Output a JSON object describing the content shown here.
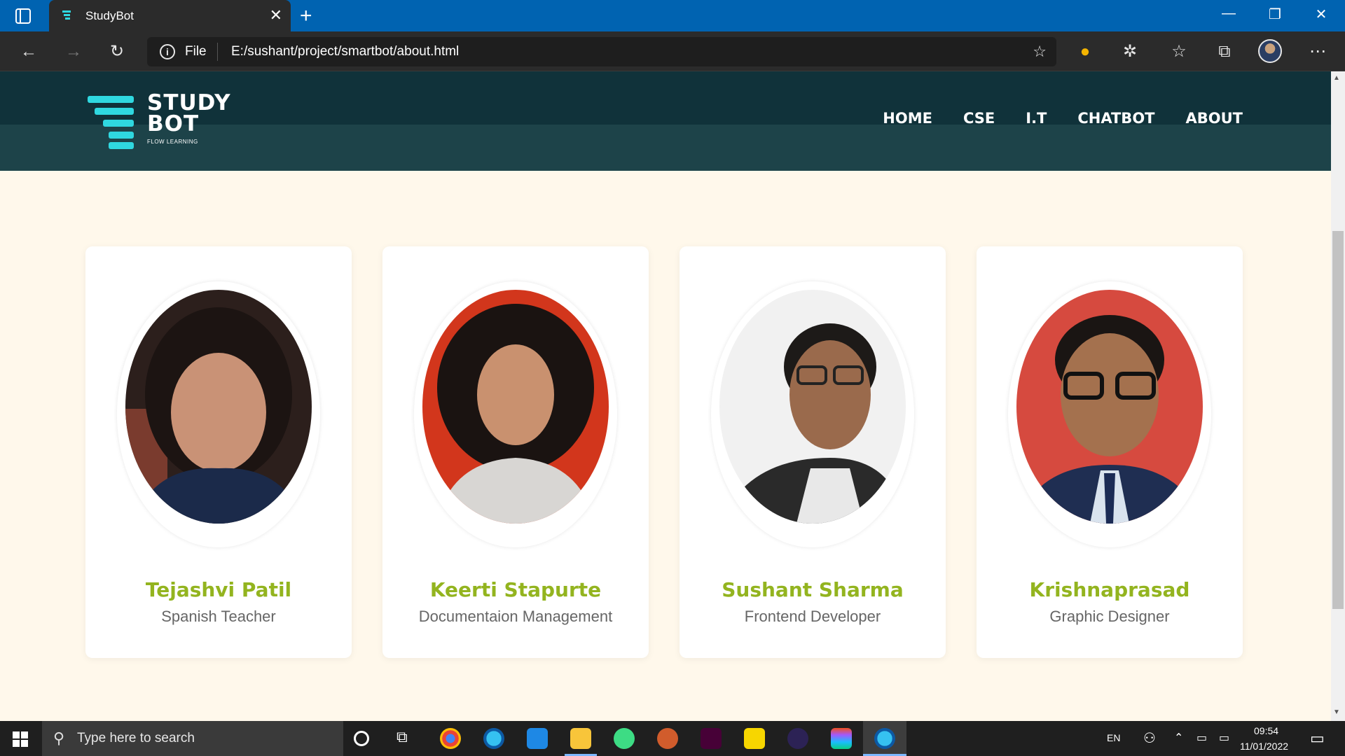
{
  "browser": {
    "tab_title": "StudyBot",
    "tab_close": "✕",
    "new_tab": "+",
    "address_scheme": "File",
    "address_url": "E:/sushant/project/smartbot/about.html",
    "window_controls": {
      "minimize": "—",
      "restore": "❐",
      "close": "✕"
    }
  },
  "site": {
    "logo_line1": "STUDY",
    "logo_line2": "BOT",
    "logo_sub": "FLOW LEARNING",
    "nav": [
      "HOME",
      "CSE",
      "I.T",
      "CHATBOT",
      "ABOUT"
    ],
    "colors": {
      "header": "#10323a",
      "accent": "#2fd8e0",
      "name": "#93b41f",
      "background": "#fff8eb"
    }
  },
  "team": [
    {
      "name": "Tejashvi Patil",
      "role": "Spanish Teacher",
      "photo_bg": "#2c1f1c"
    },
    {
      "name": "Keerti Stapurte",
      "role": "Documentaion Management",
      "photo_bg": "#d2361c"
    },
    {
      "name": "Sushant Sharma",
      "role": "Frontend Developer",
      "photo_bg": "#f1f1f1"
    },
    {
      "name": "Krishnaprasad",
      "role": "Graphic Designer",
      "photo_bg": "#d64a3f"
    }
  ],
  "taskbar": {
    "search_placeholder": "Type here to search",
    "language": "EN",
    "time": "09:54",
    "date": "11/01/2022"
  }
}
